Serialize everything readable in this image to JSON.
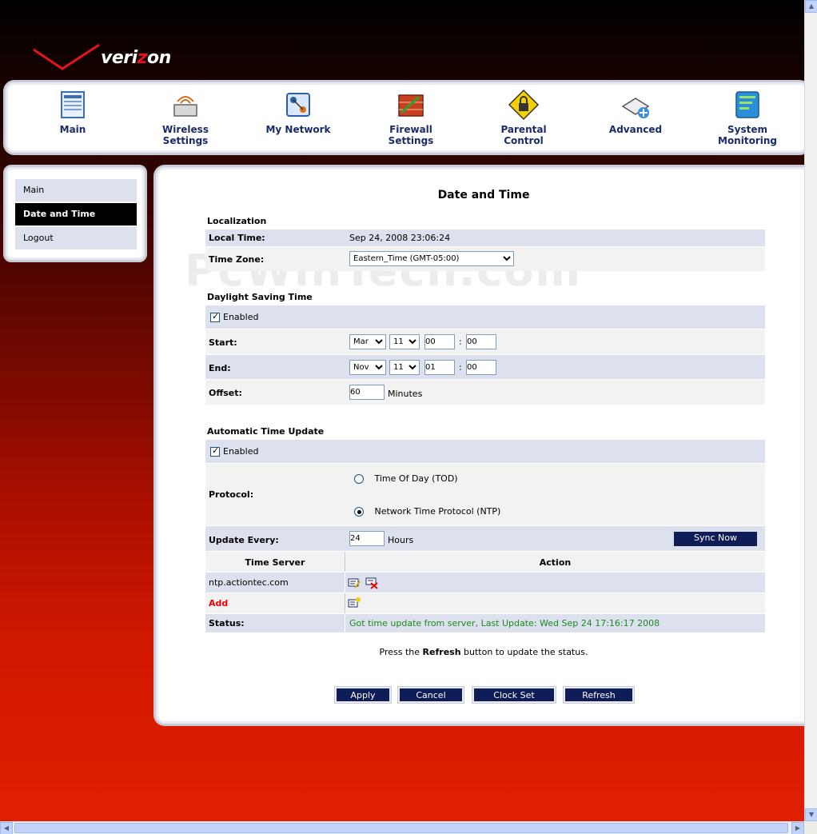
{
  "brand": {
    "name": "verizon",
    "name_pre": "veri",
    "name_z": "z",
    "name_post": "on"
  },
  "nav": {
    "main": "Main",
    "wireless_1": "Wireless",
    "wireless_2": "Settings",
    "network": "My Network",
    "firewall_1": "Firewall",
    "firewall_2": "Settings",
    "parental_1": "Parental",
    "parental_2": "Control",
    "advanced": "Advanced",
    "monitor_1": "System",
    "monitor_2": "Monitoring"
  },
  "sidebar": {
    "items": [
      {
        "label": "Main"
      },
      {
        "label": "Date and Time"
      },
      {
        "label": "Logout"
      }
    ]
  },
  "page": {
    "title": "Date and Time"
  },
  "localization": {
    "heading": "Localization",
    "local_time_label": "Local Time:",
    "local_time_value": "Sep 24, 2008 23:06:24",
    "time_zone_label": "Time Zone:",
    "time_zone_value": "Eastern_Time (GMT-05:00)"
  },
  "dst": {
    "heading": "Daylight Saving Time",
    "enabled_label": "Enabled",
    "start_label": "Start:",
    "start_month": "Mar",
    "start_day": "11",
    "start_hour": "00",
    "start_min": "00",
    "end_label": "End:",
    "end_month": "Nov",
    "end_day": "11",
    "end_hour": "01",
    "end_min": "00",
    "colon": ":",
    "offset_label": "Offset:",
    "offset_value": "60",
    "offset_unit": "Minutes"
  },
  "auto_update": {
    "heading": "Automatic Time Update",
    "enabled_label": "Enabled",
    "protocol_label": "Protocol:",
    "tod_label": "Time Of Day (TOD)",
    "ntp_label": "Network Time Protocol (NTP)",
    "update_every_label": "Update Every:",
    "update_every_value": "24",
    "update_every_unit": "Hours",
    "sync_button": "Sync Now",
    "col_server": "Time Server",
    "col_action": "Action",
    "server_1": "ntp.actiontec.com",
    "add_label": "Add",
    "status_label": "Status:",
    "status_value": "Got time update from server, Last Update: Wed Sep 24 17:16:17 2008"
  },
  "hint": {
    "pre": "Press the ",
    "bold": "Refresh",
    "post": " button to update the status."
  },
  "buttons": {
    "apply": "Apply",
    "cancel": "Cancel",
    "clock_set": "Clock Set",
    "refresh": "Refresh"
  },
  "watermark": "PcWinTech.com",
  "colors": {
    "navy": "#0e1c57",
    "row_blue": "#dde1ee",
    "status_green": "#1a8b1a",
    "accent_red": "#e8121a"
  },
  "icons": [
    "main-icon",
    "wireless-icon",
    "network-icon",
    "firewall-icon",
    "parental-lock-icon",
    "advanced-icon",
    "monitoring-icon",
    "edit-icon",
    "delete-icon",
    "add-icon",
    "checkmark-icon"
  ]
}
